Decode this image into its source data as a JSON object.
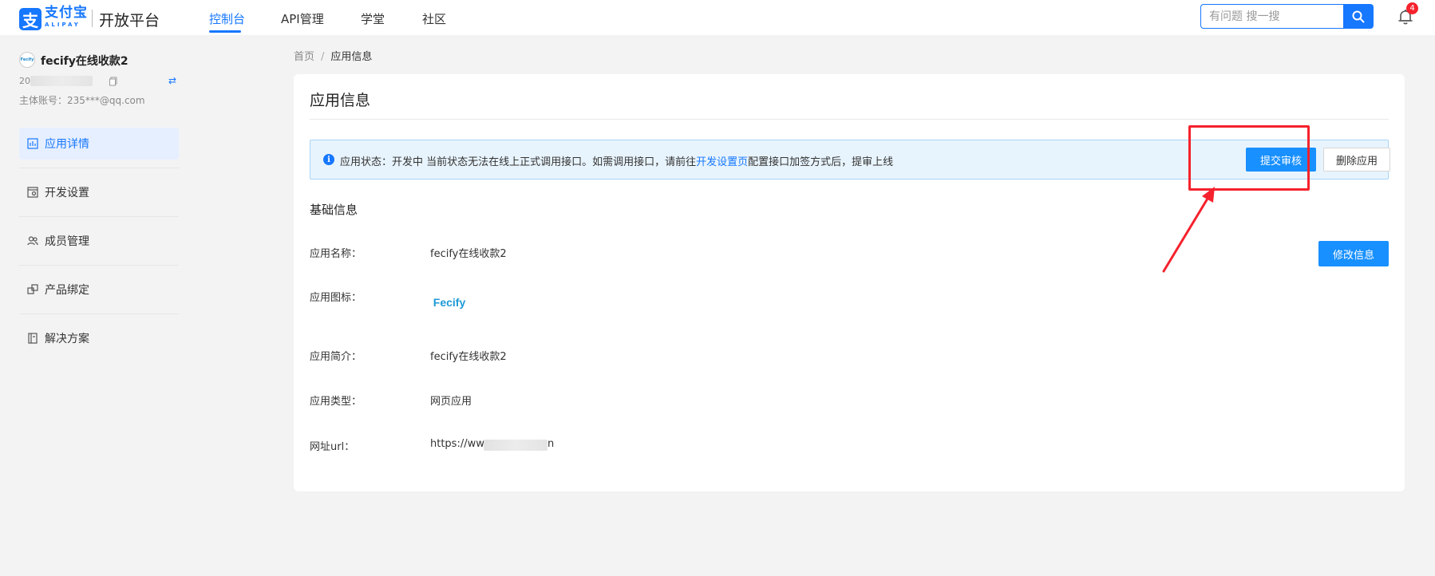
{
  "header": {
    "logo_glyph": "支",
    "logo_cn": "支付宝",
    "logo_en": "ALIPAY",
    "platform_title": "开放平台",
    "nav": [
      {
        "label": "控制台",
        "active": true
      },
      {
        "label": "API管理",
        "active": false
      },
      {
        "label": "学堂",
        "active": false
      },
      {
        "label": "社区",
        "active": false
      }
    ],
    "search_placeholder": "有问题 搜一搜",
    "search_icon": "search-icon",
    "notification_icon": "bell-icon",
    "notification_count": "4"
  },
  "sidebar": {
    "app_avatar_text": "Fecify",
    "app_name": "fecify在线收款2",
    "app_id_prefix": "20",
    "main_account": "主体账号：235***@qq.com",
    "items": [
      {
        "label": "应用详情",
        "icon": "app-detail-icon",
        "active": true
      },
      {
        "label": "开发设置",
        "icon": "dev-settings-icon",
        "active": false
      },
      {
        "label": "成员管理",
        "icon": "members-icon",
        "active": false
      },
      {
        "label": "产品绑定",
        "icon": "product-bind-icon",
        "active": false
      },
      {
        "label": "解决方案",
        "icon": "solution-icon",
        "active": false
      }
    ]
  },
  "breadcrumb": {
    "home": "首页",
    "separator": "/",
    "current": "应用信息"
  },
  "main": {
    "title": "应用信息",
    "alert": {
      "text_before": "应用状态：开发中 当前状态无法在线上正式调用接口。如需调用接口，请前往",
      "link": "开发设置页",
      "text_after": "配置接口加签方式后，提审上线"
    },
    "submit_button": "提交审核",
    "delete_button": "删除应用",
    "edit_button": "修改信息",
    "section_title": "基础信息",
    "fields": [
      {
        "label": "应用名称：",
        "value": "fecify在线收款2"
      },
      {
        "label": "应用图标：",
        "value": "Fecify"
      },
      {
        "label": "应用简介：",
        "value": "fecify在线收款2"
      },
      {
        "label": "应用类型：",
        "value": "网页应用"
      },
      {
        "label": "网址url：",
        "value_prefix": "https://ww",
        "value_suffix": "n"
      }
    ]
  },
  "colors": {
    "accent": "#1677ff",
    "alert_bg": "#e8f4fd",
    "annotation": "#f5222d",
    "page_bg": "#f3f3f4"
  }
}
